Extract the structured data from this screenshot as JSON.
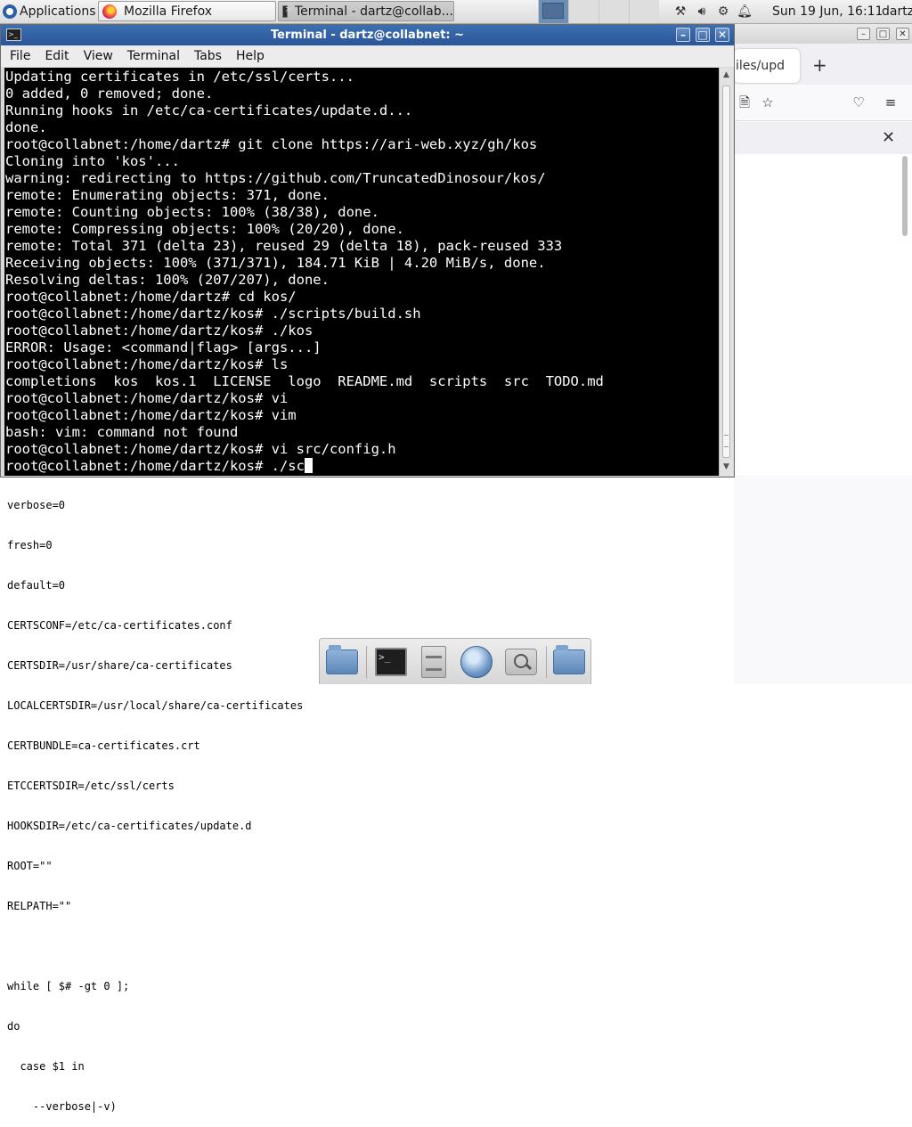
{
  "panel": {
    "applications_label": "Applications",
    "tasks": [
      {
        "label": "Mozilla Firefox"
      },
      {
        "label": "Terminal - dartz@collab..."
      }
    ],
    "clock": "Sun 19 Jun, 16:11",
    "user": "dartz"
  },
  "terminal": {
    "title": "Terminal - dartz@collabnet: ~",
    "menu": [
      "File",
      "Edit",
      "View",
      "Terminal",
      "Tabs",
      "Help"
    ],
    "lines": [
      "Updating certificates in /etc/ssl/certs...",
      "0 added, 0 removed; done.",
      "Running hooks in /etc/ca-certificates/update.d...",
      "done.",
      "root@collabnet:/home/dartz# git clone https://ari-web.xyz/gh/kos",
      "Cloning into 'kos'...",
      "warning: redirecting to https://github.com/TruncatedDinosour/kos/",
      "remote: Enumerating objects: 371, done.",
      "remote: Counting objects: 100% (38/38), done.",
      "remote: Compressing objects: 100% (20/20), done.",
      "remote: Total 371 (delta 23), reused 29 (delta 18), pack-reused 333",
      "Receiving objects: 100% (371/371), 184.71 KiB | 4.20 MiB/s, done.",
      "Resolving deltas: 100% (207/207), done.",
      "root@collabnet:/home/dartz# cd kos/",
      "root@collabnet:/home/dartz/kos# ./scripts/build.sh",
      "root@collabnet:/home/dartz/kos# ./kos",
      "ERROR: Usage: <command|flag> [args...]",
      "root@collabnet:/home/dartz/kos# ls",
      "completions  kos  kos.1  LICENSE  logo  README.md  scripts  src  TODO.md",
      "root@collabnet:/home/dartz/kos# vi",
      "root@collabnet:/home/dartz/kos# vim",
      "bash: vim: command not found",
      "root@collabnet:/home/dartz/kos# vi src/config.h"
    ],
    "current_input": "root@collabnet:/home/dartz/kos# ./sc"
  },
  "firefox_bg": {
    "tab_label": "iles/upd"
  },
  "background_doc": {
    "lines": [
      "verbose=0",
      "fresh=0",
      "default=0",
      "CERTSCONF=/etc/ca-certificates.conf",
      "CERTSDIR=/usr/share/ca-certificates",
      "LOCALCERTSDIR=/usr/local/share/ca-certificates",
      "CERTBUNDLE=ca-certificates.crt",
      "ETCCERTSDIR=/etc/ssl/certs",
      "HOOKSDIR=/etc/ca-certificates/update.d",
      "ROOT=\"\"",
      "RELPATH=\"\"",
      "",
      "while [ $# -gt 0 ];",
      "do",
      "  case $1 in",
      "    --verbose|-v)"
    ]
  }
}
